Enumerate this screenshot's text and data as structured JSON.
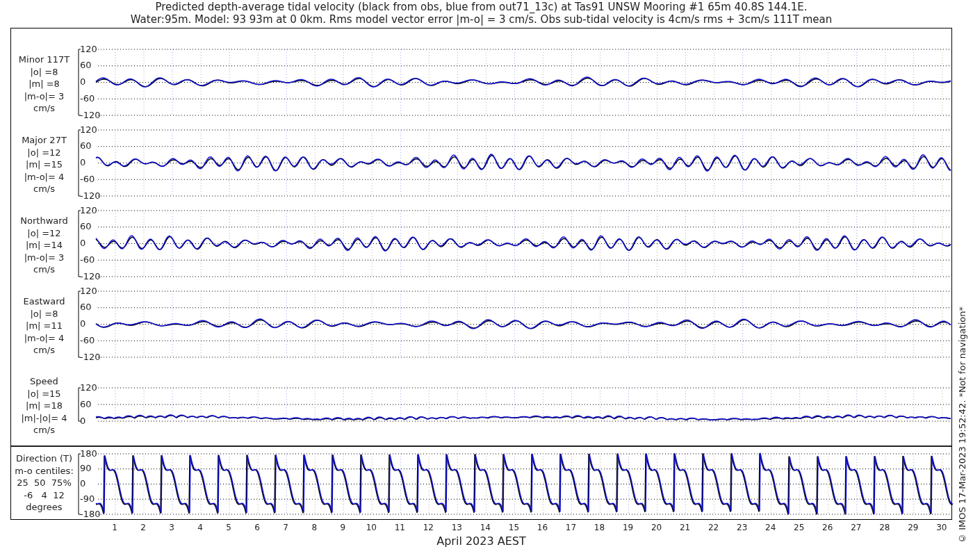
{
  "title": {
    "lines": [
      "Predicted depth-average tidal velocity (black from obs, blue from out71_13c) at Tas91 UNSW Mooring #1 65m 40.8S 144.1E.",
      "Water:95m. Model: 93 93m at 0 0km. Rms model vector error |m-o| = 3 cm/s. Obs sub-tidal velocity is 4cm/s rms + 3cm/s 111T mean"
    ]
  },
  "panels": [
    {
      "kind": "velocity",
      "label_lines": [
        "Minor 117T",
        "|o| =8",
        "|m| =8",
        "|m-o|= 3",
        "cm/s"
      ],
      "yticks": [
        "120",
        "60",
        "0",
        "-60",
        "-120"
      ]
    },
    {
      "kind": "velocity",
      "label_lines": [
        "Major 27T",
        "|o| =12",
        "|m| =15",
        "|m-o|= 4",
        "cm/s"
      ],
      "yticks": [
        "120",
        "60",
        "0",
        "-60",
        "-120"
      ]
    },
    {
      "kind": "velocity",
      "label_lines": [
        "Northward",
        "|o| =12",
        "|m| =14",
        "|m-o|= 3",
        "cm/s"
      ],
      "yticks": [
        "120",
        "60",
        "0",
        "-60",
        "-120"
      ]
    },
    {
      "kind": "velocity",
      "label_lines": [
        "Eastward",
        "|o| =8",
        "|m| =11",
        "|m-o|= 4",
        "cm/s"
      ],
      "yticks": [
        "120",
        "60",
        "0",
        "-60",
        "-120"
      ]
    },
    {
      "kind": "speed",
      "label_lines": [
        "Speed",
        "|o| =15",
        "|m| =18",
        "|m|-|o|= 4",
        "cm/s"
      ],
      "yticks": [
        "120",
        "60",
        "0"
      ]
    }
  ],
  "direction_panel": {
    "label_lines": [
      "Direction (T)",
      "m-o centiles:",
      "25  50  75%",
      "-6   4  12",
      "degrees"
    ],
    "yticks": [
      "180",
      "90",
      "0",
      "-90",
      "-180"
    ]
  },
  "x_axis": {
    "ticks": [
      "1",
      "2",
      "3",
      "4",
      "5",
      "6",
      "7",
      "8",
      "9",
      "10",
      "11",
      "12",
      "13",
      "14",
      "15",
      "16",
      "17",
      "18",
      "19",
      "20",
      "21",
      "22",
      "23",
      "24",
      "25",
      "26",
      "27",
      "28",
      "29",
      "30"
    ],
    "label": "April 2023 AEST"
  },
  "footer_note": "© IMOS 17-Mar-2023 19:52:42. *Not for navigation*"
}
